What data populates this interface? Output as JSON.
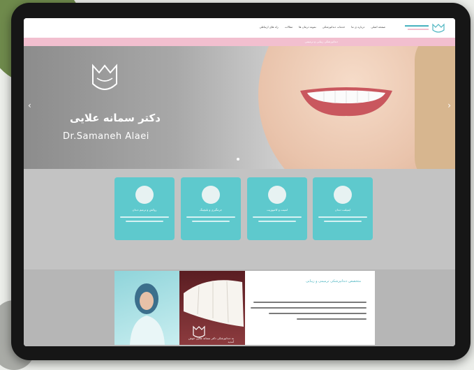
{
  "nav": {
    "links": [
      "صفحه اصلی",
      "درباره ی ما",
      "خدمات دندانپزشکی",
      "نمونه درمان ها",
      "مقالات",
      "راه های ارتباطی"
    ],
    "logo_text": "دکتر سمانه علایی"
  },
  "topbar": {
    "text": "دندانپزشکی زیبایی و ترمیمی"
  },
  "hero": {
    "name_fa": "دکتر سمانه علایی",
    "name_en": "Dr.Samaneh Alaei",
    "prev_arrow": "‹",
    "next_arrow": "›"
  },
  "services": [
    {
      "title": "ایمپلنت دندان"
    },
    {
      "title": "لمینت و کامپوزیت"
    },
    {
      "title": "جرمگیری و بلیچینگ"
    },
    {
      "title": "روکش و ترمیم دندان"
    }
  ],
  "about": {
    "title": "متخصص دندانپزشکی ترمیمی و زیبایی",
    "badge_text": "به دندانپزشکی دکتر سمانه علایی خوش آمدید"
  },
  "colors": {
    "accent": "#5ec9cd",
    "pink": "#f2bfcf",
    "title_teal": "#4fb6c2"
  }
}
